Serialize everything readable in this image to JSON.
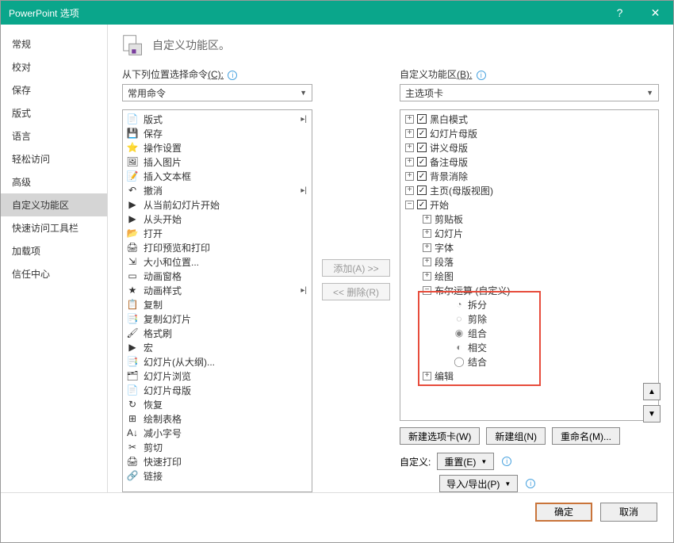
{
  "titlebar": {
    "title": "PowerPoint 选项",
    "help": "?",
    "close": "✕"
  },
  "sidebar": {
    "items": [
      "常规",
      "校对",
      "保存",
      "版式",
      "语言",
      "轻松访问",
      "高级",
      "自定义功能区",
      "快速访问工具栏",
      "加载项",
      "信任中心"
    ],
    "selected": 7
  },
  "header": {
    "text": "自定义功能区。"
  },
  "left": {
    "label_prefix": "从下列位置选择命令",
    "label_accel": "(C):",
    "combo": "常用命令",
    "commands": [
      {
        "icon": "📄",
        "label": "版式",
        "sub": true
      },
      {
        "icon": "💾",
        "label": "保存"
      },
      {
        "icon": "⭐",
        "label": "操作设置"
      },
      {
        "icon": "🖼",
        "label": "插入图片"
      },
      {
        "icon": "📝",
        "label": "插入文本框"
      },
      {
        "icon": "↶",
        "label": "撤消",
        "sub": true
      },
      {
        "icon": "▶",
        "label": "从当前幻灯片开始"
      },
      {
        "icon": "▶",
        "label": "从头开始"
      },
      {
        "icon": "📂",
        "label": "打开"
      },
      {
        "icon": "🖨",
        "label": "打印预览和打印"
      },
      {
        "icon": "⇲",
        "label": "大小和位置..."
      },
      {
        "icon": "▭",
        "label": "动画窗格"
      },
      {
        "icon": "★",
        "label": "动画样式",
        "sub": true
      },
      {
        "icon": "📋",
        "label": "复制"
      },
      {
        "icon": "📑",
        "label": "复制幻灯片"
      },
      {
        "icon": "🖌",
        "label": "格式刷"
      },
      {
        "icon": "▶",
        "label": "宏"
      },
      {
        "icon": "📑",
        "label": "幻灯片(从大纲)..."
      },
      {
        "icon": "🗂",
        "label": "幻灯片浏览"
      },
      {
        "icon": "📄",
        "label": "幻灯片母版"
      },
      {
        "icon": "↻",
        "label": "恢复"
      },
      {
        "icon": "⊞",
        "label": "绘制表格"
      },
      {
        "icon": "A↓",
        "label": "减小字号"
      },
      {
        "icon": "✂",
        "label": "剪切"
      },
      {
        "icon": "🖨",
        "label": "快速打印"
      },
      {
        "icon": "🔗",
        "label": "链接"
      }
    ]
  },
  "mid": {
    "add": "添加(A) >>",
    "remove": "<< 删除(R)"
  },
  "right": {
    "label_prefix": "自定义功能区",
    "label_accel": "(B):",
    "combo": "主选项卡",
    "tree": [
      {
        "indent": 0,
        "exp": "+",
        "chk": true,
        "label": "黑白模式"
      },
      {
        "indent": 0,
        "exp": "+",
        "chk": true,
        "label": "幻灯片母版"
      },
      {
        "indent": 0,
        "exp": "+",
        "chk": true,
        "label": "讲义母版"
      },
      {
        "indent": 0,
        "exp": "+",
        "chk": true,
        "label": "备注母版"
      },
      {
        "indent": 0,
        "exp": "+",
        "chk": true,
        "label": "背景消除"
      },
      {
        "indent": 0,
        "exp": "+",
        "chk": true,
        "label": "主页(母版视图)"
      },
      {
        "indent": 0,
        "exp": "−",
        "chk": true,
        "label": "开始"
      },
      {
        "indent": 1,
        "exp": "+",
        "label": "剪贴板"
      },
      {
        "indent": 1,
        "exp": "+",
        "label": "幻灯片"
      },
      {
        "indent": 1,
        "exp": "+",
        "label": "字体"
      },
      {
        "indent": 1,
        "exp": "+",
        "label": "段落"
      },
      {
        "indent": 1,
        "exp": "+",
        "label": "绘图"
      },
      {
        "indent": 1,
        "exp": "−",
        "label": "布尔运算 (自定义)"
      },
      {
        "indent": 2,
        "ic": "◔",
        "label": "拆分"
      },
      {
        "indent": 2,
        "ic": "◌",
        "label": "剪除"
      },
      {
        "indent": 2,
        "ic": "◉",
        "label": "组合"
      },
      {
        "indent": 2,
        "ic": "◐",
        "label": "相交"
      },
      {
        "indent": 2,
        "ic": "◯",
        "label": "结合"
      },
      {
        "indent": 1,
        "exp": "+",
        "label": "编辑"
      }
    ],
    "new_tab": "新建选项卡(W)",
    "new_group": "新建组(N)",
    "rename": "重命名(M)...",
    "custom_label": "自定义:",
    "reset": "重置(E)",
    "import_export": "导入/导出(P)"
  },
  "footer": {
    "ok": "确定",
    "cancel": "取消"
  }
}
